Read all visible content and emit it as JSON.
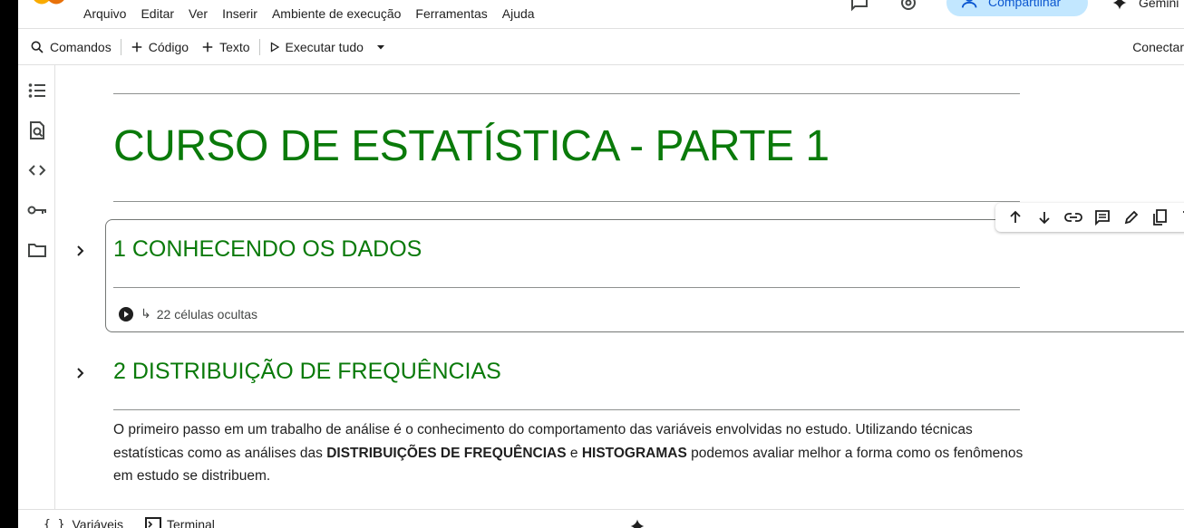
{
  "menu": {
    "items": [
      "Arquivo",
      "Editar",
      "Ver",
      "Inserir",
      "Ambiente de execução",
      "Ferramentas",
      "Ajuda"
    ],
    "share_label": "Compartilhar",
    "gemini_label": "Gemini"
  },
  "toolbar": {
    "commands_label": "Comandos",
    "code_label": "Código",
    "text_label": "Texto",
    "run_all_label": "Executar tudo",
    "connect_label": "Conectar"
  },
  "rail": {
    "icons": [
      "toc-icon",
      "find-replace-icon",
      "code-snippets-icon",
      "secrets-key-icon",
      "files-folder-icon"
    ]
  },
  "notebook": {
    "title": "CURSO DE ESTATÍSTICA - PARTE 1",
    "section1": {
      "heading": "1 CONHECENDO OS DADOS",
      "hidden_cells": "22 células ocultas"
    },
    "section2": {
      "heading": "2 DISTRIBUIÇÃO DE FREQUÊNCIAS",
      "para_1": "O primeiro passo em um trabalho de análise é o conhecimento do comportamento das variáveis envolvidas no estudo. Utilizando técnicas estatísticas como as análises das ",
      "para_bold_1": "DISTRIBUIÇÕES DE FREQUÊNCIAS",
      "para_2": " e ",
      "para_bold_2": "HISTOGRAMAS",
      "para_3": " podemos avaliar melhor a forma como os fenômenos em estudo se distribuem."
    },
    "cell_toolbar": [
      "move-up-icon",
      "move-down-icon",
      "link-icon",
      "comment-icon",
      "edit-icon",
      "mirror-cell-icon",
      "delete-icon"
    ]
  },
  "statusbar": {
    "variables_label": "Variáveis",
    "terminal_label": "Terminal"
  },
  "colors": {
    "heading_green": "#0a7a0a",
    "share_bg": "#c2e7ff",
    "share_text": "#0b57d0"
  }
}
